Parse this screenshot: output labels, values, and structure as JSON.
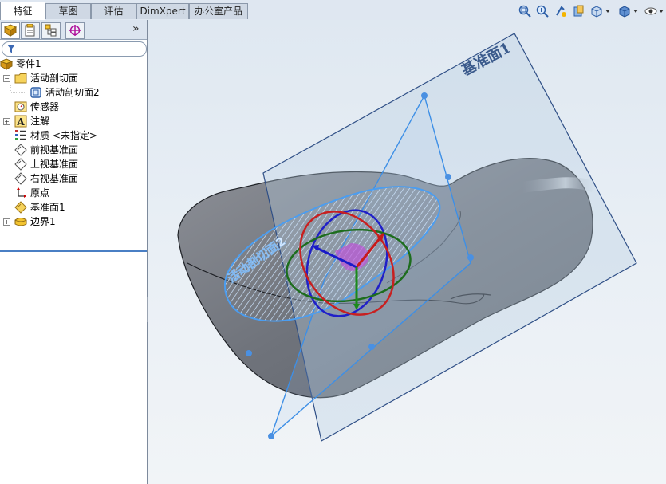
{
  "tabs": [
    "特征",
    "草图",
    "评估",
    "DimXpert",
    "办公室产品"
  ],
  "active_tab": "特征",
  "toolbar_icons": [
    "zoom-to-fit-icon",
    "zoom-area-icon",
    "previous-view-icon",
    "section-view-icon",
    "view-orientation-icon",
    "display-style-icon",
    "hide-show-icon"
  ],
  "panel_tabs": [
    "featuremanager-icon",
    "propertymanager-icon",
    "configurationmanager-icon",
    "dimxpert-manager-icon"
  ],
  "panel_more": "»",
  "tree": [
    {
      "label": "零件1",
      "icon": "part-icon"
    },
    {
      "label": "活动剖切面",
      "icon": "folder-icon"
    },
    {
      "label": "活动剖切面2",
      "icon": "section-plane-icon"
    },
    {
      "label": "传感器",
      "icon": "sensor-icon"
    },
    {
      "label": "注解",
      "icon": "annotation-icon"
    },
    {
      "label": "材质 <未指定>",
      "icon": "material-icon"
    },
    {
      "label": "前视基准面",
      "icon": "plane-icon"
    },
    {
      "label": "上视基准面",
      "icon": "plane-icon"
    },
    {
      "label": "右视基准面",
      "icon": "plane-icon"
    },
    {
      "label": "原点",
      "icon": "origin-icon"
    },
    {
      "label": "基准面1",
      "icon": "plane-icon"
    },
    {
      "label": "边界1",
      "icon": "boundary-icon"
    }
  ],
  "viewport": {
    "plane_label": "基准面1",
    "section_label": "活动剖切面2"
  }
}
